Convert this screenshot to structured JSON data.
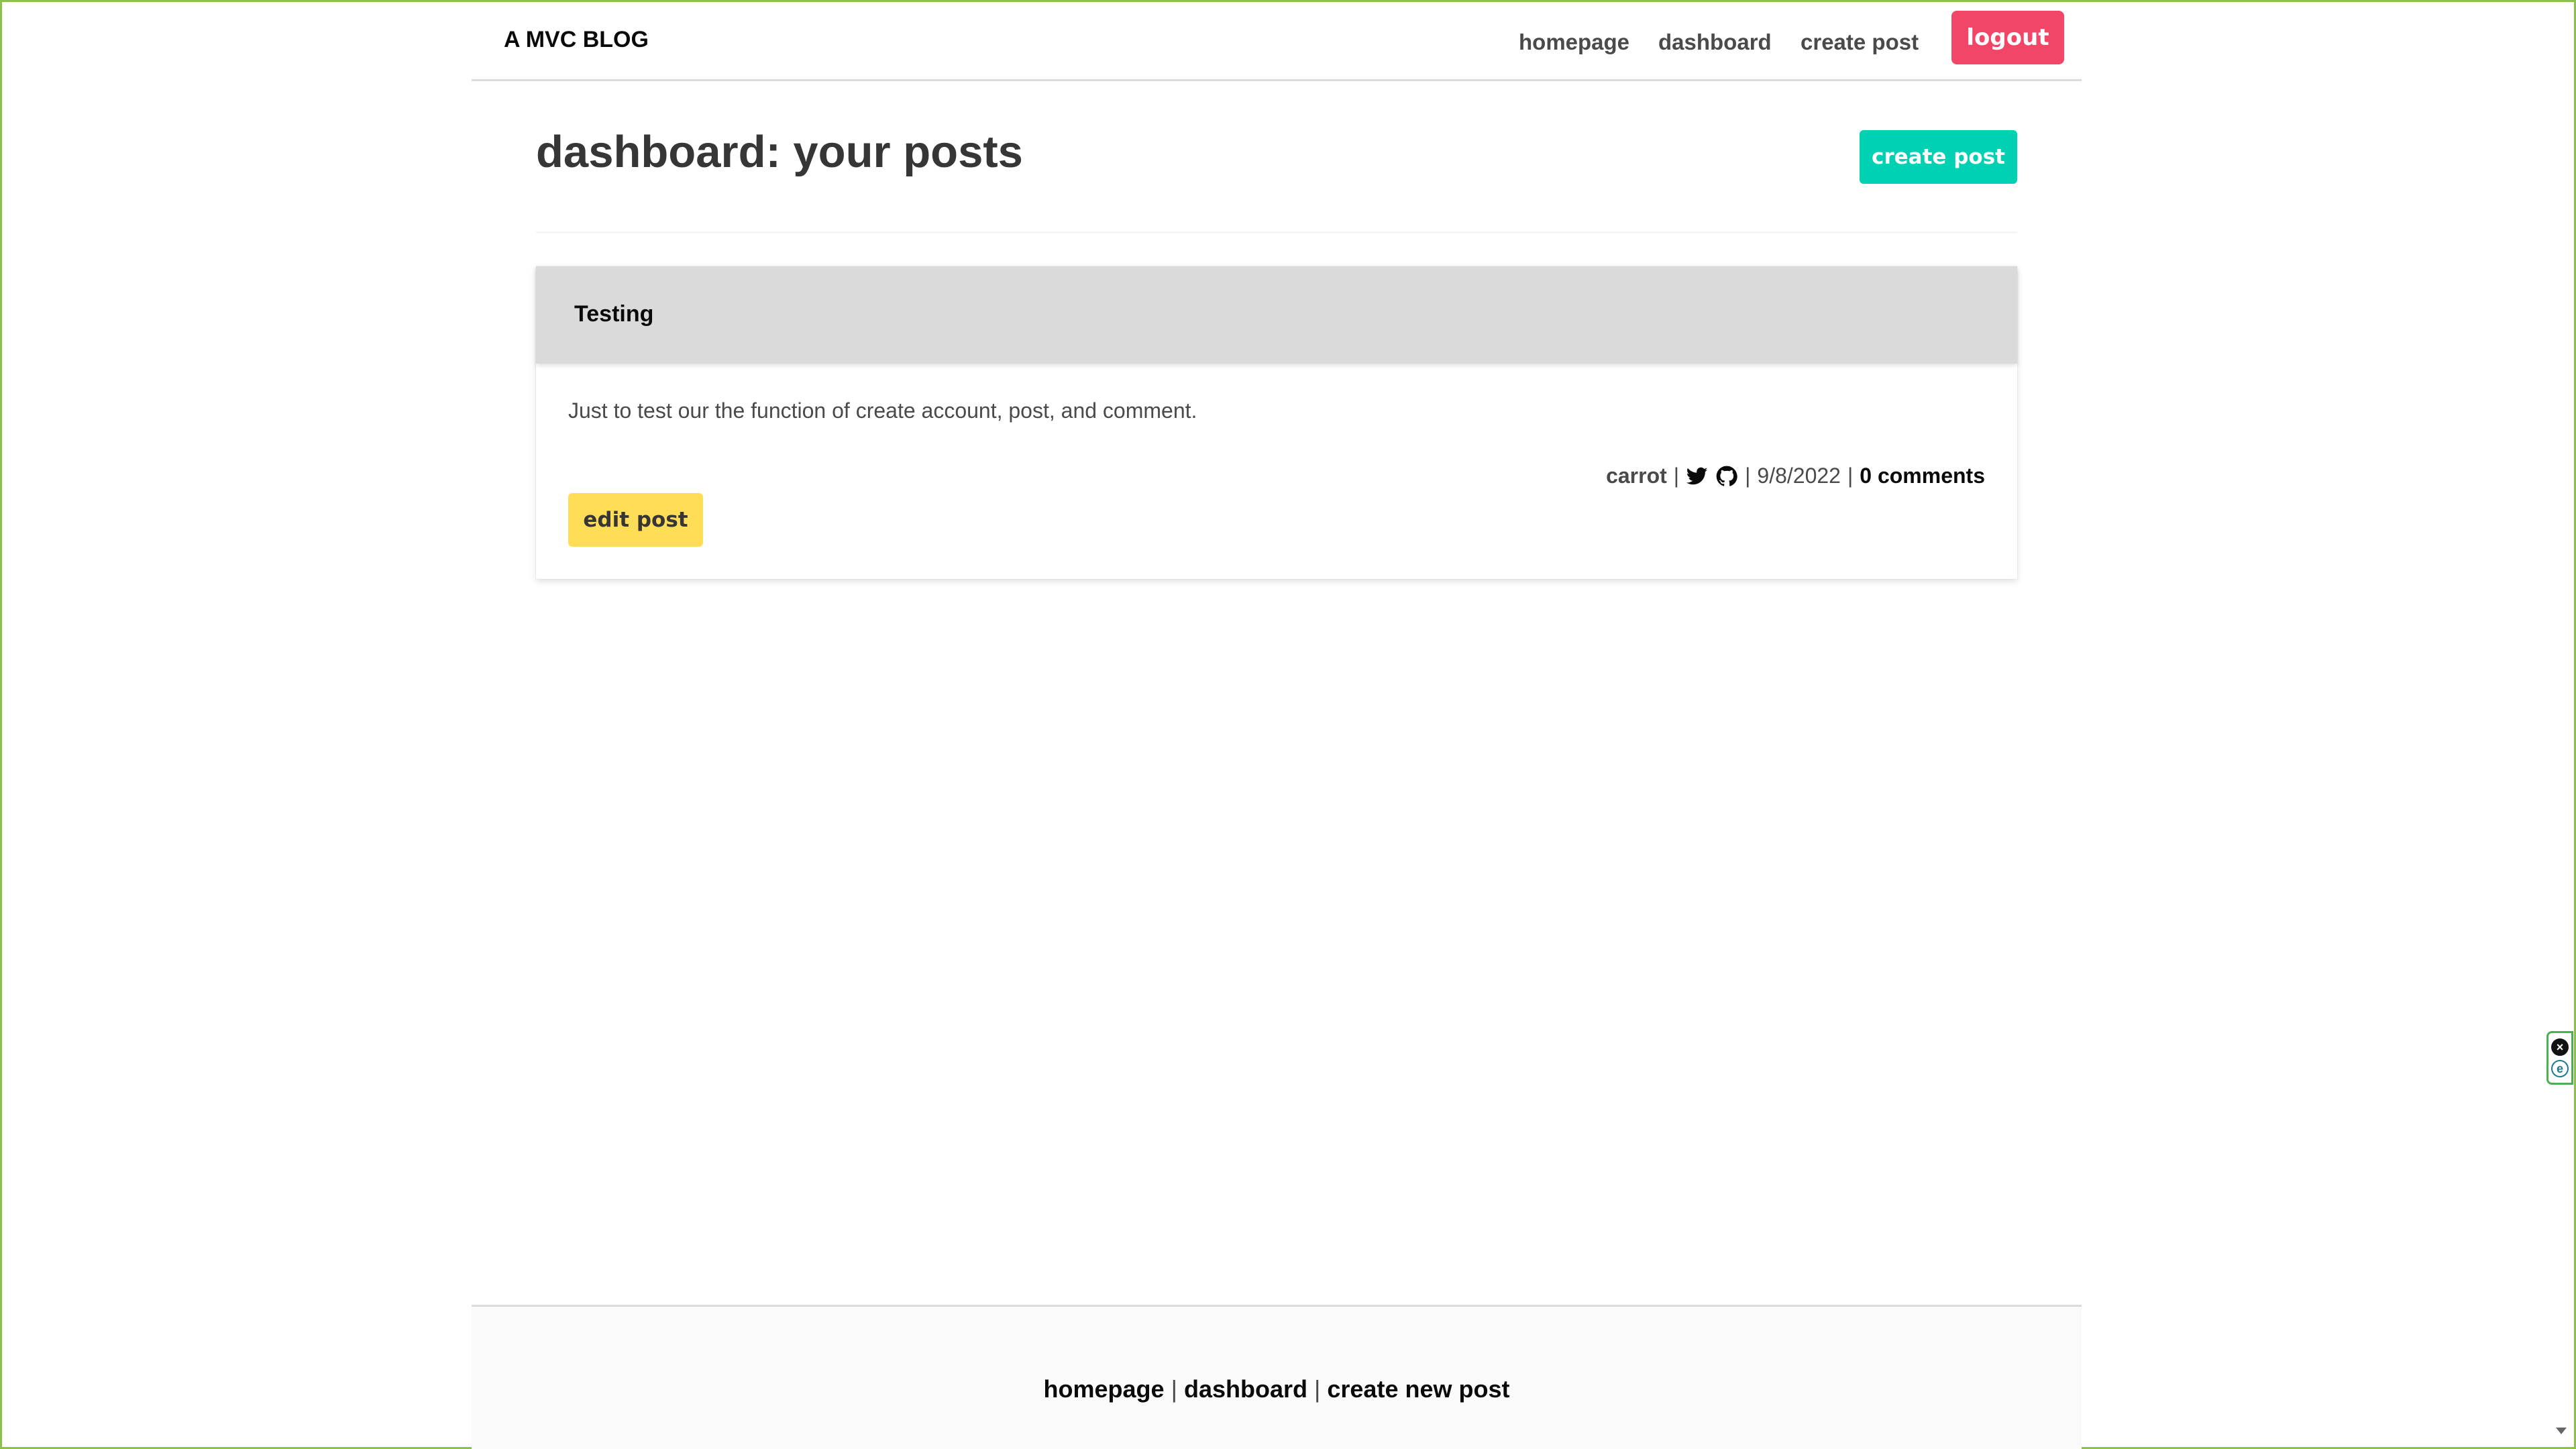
{
  "nav": {
    "brand": "A MVC BLOG",
    "links": [
      "homepage",
      "dashboard",
      "create post"
    ],
    "logout": "logout"
  },
  "page": {
    "title": "dashboard: your posts",
    "create_button": "create post"
  },
  "post": {
    "title": "Testing",
    "body": "Just to test our the function of create account, post, and comment.",
    "author": "carrot",
    "separator": "|",
    "date": "9/8/2022",
    "comments": "0 comments",
    "edit_button": "edit post",
    "icons": [
      "twitter-icon",
      "github-icon"
    ]
  },
  "footer": {
    "links": [
      "homepage",
      "dashboard",
      "create new post"
    ],
    "separator": "|"
  },
  "colors": {
    "logout": "#f14668",
    "create": "#00d1b2",
    "edit": "#ffdd57",
    "card_header": "#dadada"
  }
}
